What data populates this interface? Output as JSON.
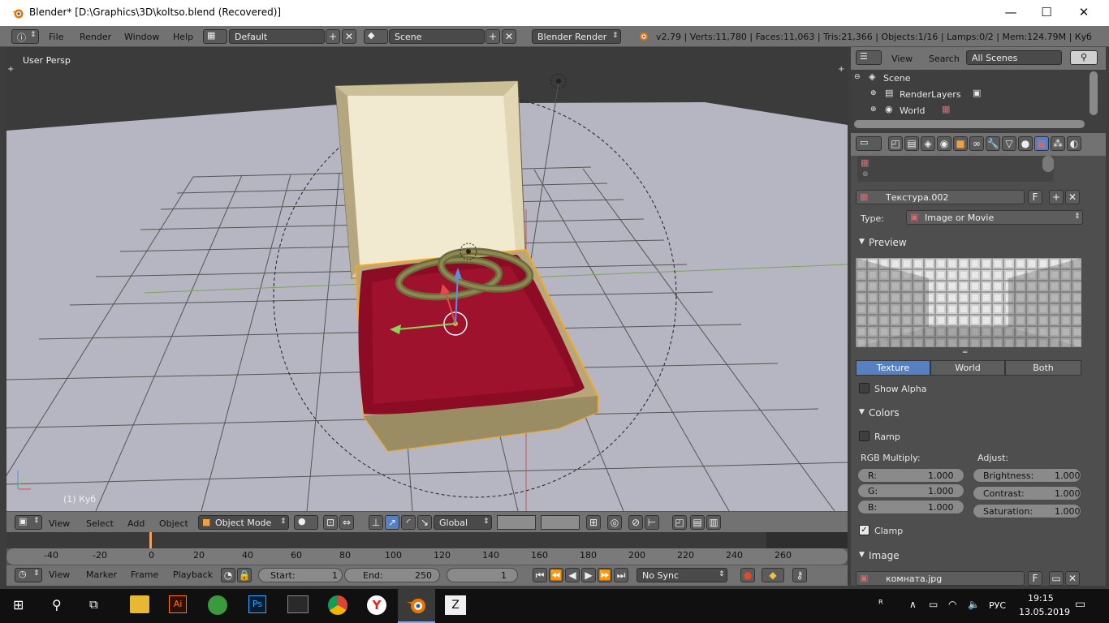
{
  "window": {
    "title": "Blender* [D:\\Graphics\\3D\\koltso.blend (Recovered)]",
    "minimize": "—",
    "maximize": "☐",
    "close": "✕"
  },
  "info_header": {
    "menu": [
      "File",
      "Render",
      "Window",
      "Help"
    ],
    "layout": "Default",
    "scene": "Scene",
    "engine": "Blender Render",
    "stats": "v2.79 | Verts:11,780 | Faces:11,063 | Tris:21,366 | Objects:1/16 | Lamps:0/2 | Mem:124.79M | Куб"
  },
  "viewport": {
    "view_name": "User Persp",
    "object_label": "(1) Куб"
  },
  "viewport_header": {
    "menu": [
      "View",
      "Select",
      "Add",
      "Object"
    ],
    "mode": "Object Mode",
    "orientation": "Global"
  },
  "timeline": {
    "ticks": [
      "-40",
      "-20",
      "0",
      "20",
      "40",
      "60",
      "80",
      "100",
      "120",
      "140",
      "160",
      "180",
      "200",
      "220",
      "240",
      "260"
    ],
    "menu": [
      "View",
      "Marker",
      "Frame",
      "Playback"
    ],
    "start_label": "Start:",
    "start_value": "1",
    "end_label": "End:",
    "end_value": "250",
    "current_frame": "1",
    "sync": "No Sync"
  },
  "outliner": {
    "menu": [
      "View",
      "Search"
    ],
    "filter": "All Scenes",
    "items": [
      "Scene",
      "RenderLayers",
      "World"
    ]
  },
  "properties": {
    "texture_name": "Текстура.002",
    "texture_flag": "F",
    "type_label": "Type:",
    "type_value": "Image or Movie",
    "preview_title": "Preview",
    "preview_tabs": [
      "Texture",
      "World",
      "Both"
    ],
    "show_alpha": "Show Alpha",
    "colors_title": "Colors",
    "ramp": "Ramp",
    "rgb_multiply": "RGB Multiply:",
    "adjust": "Adjust:",
    "r_label": "R:",
    "r_value": "1.000",
    "g_label": "G:",
    "g_value": "1.000",
    "b_label": "B:",
    "b_value": "1.000",
    "brightness_label": "Brightness:",
    "brightness_value": "1.000",
    "contrast_label": "Contrast:",
    "contrast_value": "1.000",
    "saturation_label": "Saturation:",
    "saturation_value": "1.000",
    "clamp": "Clamp",
    "image_title": "Image",
    "image_name": "комната.jpg",
    "image_flag": "F"
  },
  "taskbar": {
    "lang": "РУС",
    "time": "19:15",
    "date": "13.05.2019"
  },
  "colors": {
    "active_tab": "#5680c2",
    "selection_outline": "#f5a623"
  }
}
